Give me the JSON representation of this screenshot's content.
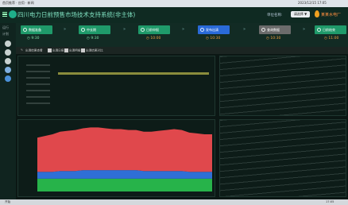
{
  "os_bar": {
    "left_text": "首页推荐 · 应用 · 新闻",
    "right_text": "2023/12/15 17:05"
  },
  "header": {
    "title": "四川电力日前预售市场技术支持系统(非主体)",
    "unit_label": "单位名称:",
    "unit_value": "请选择 ▼",
    "user": "某某水电厂"
  },
  "sidebar": {
    "labels": [
      "运行",
      "计划"
    ]
  },
  "steps": [
    {
      "label": "数据准备",
      "time": "9:30",
      "color": "#1f9a6a",
      "time_color": "#7ee0a8"
    },
    {
      "label": "中长期",
      "time": "9:30",
      "color": "#1f9a6a",
      "time_color": "#7ee0a8"
    },
    {
      "label": "日前申报",
      "time": "10:00",
      "color": "#1f9a6a",
      "time_color": "#f0a040"
    },
    {
      "label": "发布出清",
      "time": "10:30",
      "color": "#2a6ad8",
      "time_color": "#f0a040"
    },
    {
      "label": "查询数据",
      "time": "10:30",
      "color": "#6b6b6b",
      "time_color": "#f0a040"
    },
    {
      "label": "日前结束",
      "time": "11:00",
      "color": "#1f9a6a",
      "time_color": "#f0a040"
    }
  ],
  "toolbar": {
    "items": [
      "出清结果查看",
      "出清日报",
      "出清明细",
      "出清结果对比"
    ]
  },
  "chart_data": {
    "type": "area",
    "series": [
      {
        "values": [
          15,
          15,
          15,
          15,
          15,
          15,
          15,
          15,
          15,
          15,
          15,
          15,
          15,
          15,
          15,
          15,
          15,
          15,
          15,
          15,
          15,
          15,
          15,
          15
        ],
        "color": "#27b34a"
      },
      {
        "values": [
          8,
          8,
          8,
          9,
          9,
          9,
          10,
          10,
          10,
          10,
          10,
          10,
          10,
          10,
          9,
          9,
          9,
          9,
          9,
          9,
          8,
          8,
          8,
          8
        ],
        "color": "#2f6fd6"
      },
      {
        "values": [
          40,
          42,
          44,
          46,
          47,
          48,
          49,
          50,
          50,
          49,
          48,
          48,
          47,
          47,
          46,
          46,
          47,
          48,
          49,
          48,
          46,
          45,
          44,
          44
        ],
        "color": "#e0484c"
      }
    ],
    "ylim": [
      0,
      80
    ]
  },
  "taskbar": {
    "left_text": "开始",
    "right_text": "17:05"
  }
}
